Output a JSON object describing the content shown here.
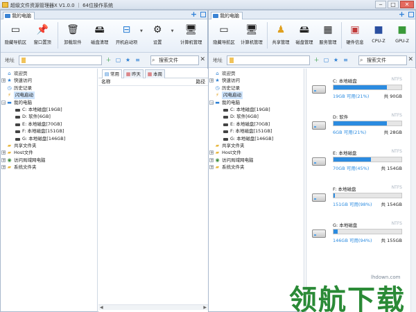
{
  "window": {
    "title": "超级文件资源管理器X V1.0.0 ｜ 64位操作系统",
    "controls": {
      "minimize": "‒",
      "maximize": "□",
      "close": "✕"
    }
  },
  "left_pane": {
    "tab_label": "我的电脑",
    "toolbar": [
      {
        "label": "隐藏导航区",
        "icon": "layout-icon"
      },
      {
        "label": "窗口置顶",
        "icon": "pin-icon"
      },
      {
        "label": "卸载软件",
        "icon": "uninstall-icon"
      },
      {
        "label": "磁盘清理",
        "icon": "disk-clean-icon"
      },
      {
        "label": "开机启动项",
        "icon": "startup-icon"
      },
      {
        "label": "设置",
        "icon": "gear-icon"
      },
      {
        "label": "计算机管理",
        "icon": "computer-manage-icon"
      }
    ],
    "address": {
      "label": "地址",
      "value": ""
    },
    "search": {
      "placeholder": "搜索文件"
    },
    "tree": [
      {
        "label": "欢迎页",
        "icon": "home-icon",
        "level": 0,
        "expander": ""
      },
      {
        "label": "快速访问",
        "icon": "star-icon",
        "level": 0,
        "expander": "+"
      },
      {
        "label": "历史记录",
        "icon": "history-icon",
        "level": 0,
        "expander": ""
      },
      {
        "label": "闪电启动",
        "icon": "lightning-icon",
        "level": 0,
        "expander": "",
        "selected": true
      },
      {
        "label": "我的电脑",
        "icon": "computer-icon",
        "level": 0,
        "expander": "−"
      },
      {
        "label": "C: 本地磁盘[19GB]",
        "icon": "drive-icon",
        "level": 1,
        "expander": ""
      },
      {
        "label": "D: 软件[6GB]",
        "icon": "drive-icon",
        "level": 1,
        "expander": ""
      },
      {
        "label": "E: 本地磁盘[70GB]",
        "icon": "drive-icon",
        "level": 1,
        "expander": ""
      },
      {
        "label": "F: 本地磁盘[151GB]",
        "icon": "drive-icon",
        "level": 1,
        "expander": ""
      },
      {
        "label": "G: 本地磁盘[146GB]",
        "icon": "drive-icon",
        "level": 1,
        "expander": ""
      },
      {
        "label": "共享文件夹",
        "icon": "folder-icon",
        "level": 0,
        "expander": ""
      },
      {
        "label": "Host文件",
        "icon": "folder-icon",
        "level": 0,
        "expander": "+"
      },
      {
        "label": "访问局域网电脑",
        "icon": "network-icon",
        "level": 0,
        "expander": "+"
      },
      {
        "label": "系统文件夹",
        "icon": "folder-icon",
        "level": 0,
        "expander": "+"
      }
    ],
    "list_tabs": [
      {
        "label": "常用",
        "icon": "common-icon",
        "active": true
      },
      {
        "label": "昨天",
        "icon": "calendar-icon",
        "active": false
      },
      {
        "label": "本周",
        "icon": "week-icon",
        "active": false
      }
    ],
    "list_columns": {
      "name": "名称",
      "path": "路径"
    }
  },
  "right_pane": {
    "tab_label": "我的电脑",
    "toolbar": [
      {
        "label": "隐藏导航区",
        "icon": "layout-icon"
      },
      {
        "label": "计算机管理",
        "icon": "computer-manage-icon"
      },
      {
        "label": "共享管理",
        "icon": "share-icon"
      },
      {
        "label": "磁盘管理",
        "icon": "disk-icon"
      },
      {
        "label": "服务管理",
        "icon": "service-icon"
      },
      {
        "label": "硬件信息",
        "icon": "hardware-icon"
      },
      {
        "label": "CPU-Z",
        "icon": "cpuz-icon"
      },
      {
        "label": "GPU-Z",
        "icon": "gpuz-icon"
      }
    ],
    "address": {
      "label": "地址",
      "value": ""
    },
    "search": {
      "placeholder": "搜索文件"
    },
    "drives": [
      {
        "name": "C: 本地磁盘",
        "fs": "NTFS",
        "free": "19GB 可用(21%)",
        "total": "共 90GB",
        "used_fraction": 0.79
      },
      {
        "name": "D: 软件",
        "fs": "NTFS",
        "free": "6GB 可用(21%)",
        "total": "共 28GB",
        "used_fraction": 0.79
      },
      {
        "name": "E: 本地磁盘",
        "fs": "NTFS",
        "free": "70GB 可用(45%)",
        "total": "共 154GB",
        "used_fraction": 0.55
      },
      {
        "name": "F: 本地磁盘",
        "fs": "NTFS",
        "free": "151GB 可用(98%)",
        "total": "共 154GB",
        "used_fraction": 0.02
      },
      {
        "name": "G: 本地磁盘",
        "fs": "NTFS",
        "free": "146GB 可用(94%)",
        "total": "共 155GB",
        "used_fraction": 0.06
      }
    ]
  },
  "watermark": {
    "text": "领航下载",
    "url": "lhdown.com"
  },
  "colors": {
    "accent": "#2b8be0",
    "watermark": "#2a8a36",
    "selection": "#cde3fb"
  }
}
